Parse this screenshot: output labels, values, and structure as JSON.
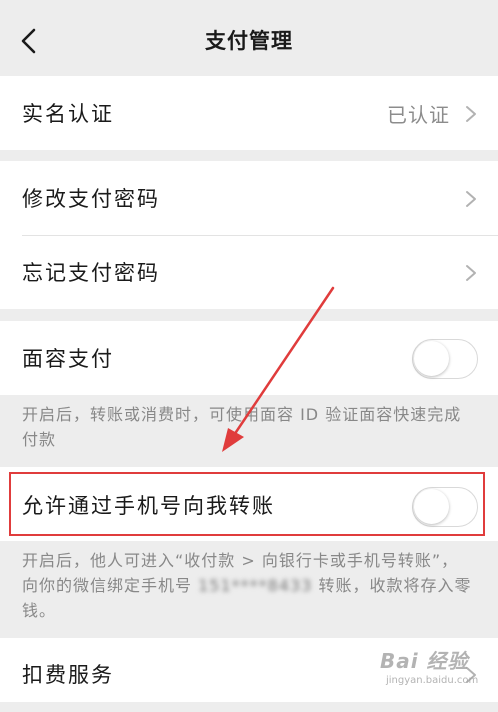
{
  "header": {
    "title": "支付管理",
    "back_icon": "chevron-left-icon"
  },
  "realname": {
    "label": "实名认证",
    "value": "已认证"
  },
  "password": {
    "change_label": "修改支付密码",
    "forgot_label": "忘记支付密码"
  },
  "faceid": {
    "label": "面容支付",
    "enabled": false,
    "hint": "开启后，转账或消费时，可使用面容 ID 验证面容快速完成付款"
  },
  "phone_transfer": {
    "label": "允许通过手机号向我转账",
    "enabled": false,
    "hint_part1": "开启后，他人可进入“收付款 > 向银行卡或手机号转账”，向你的微信绑定手机号",
    "masked_phone": "151****8433",
    "hint_part2": "转账，收款将存入零钱。"
  },
  "deduction": {
    "label": "扣费服务"
  },
  "colors": {
    "background": "#ededed",
    "card": "#ffffff",
    "annotation": "#e03c3c",
    "muted_text": "#888888"
  },
  "watermark": {
    "main": "Bai 经验",
    "sub": "jingyan.baidu.com"
  }
}
